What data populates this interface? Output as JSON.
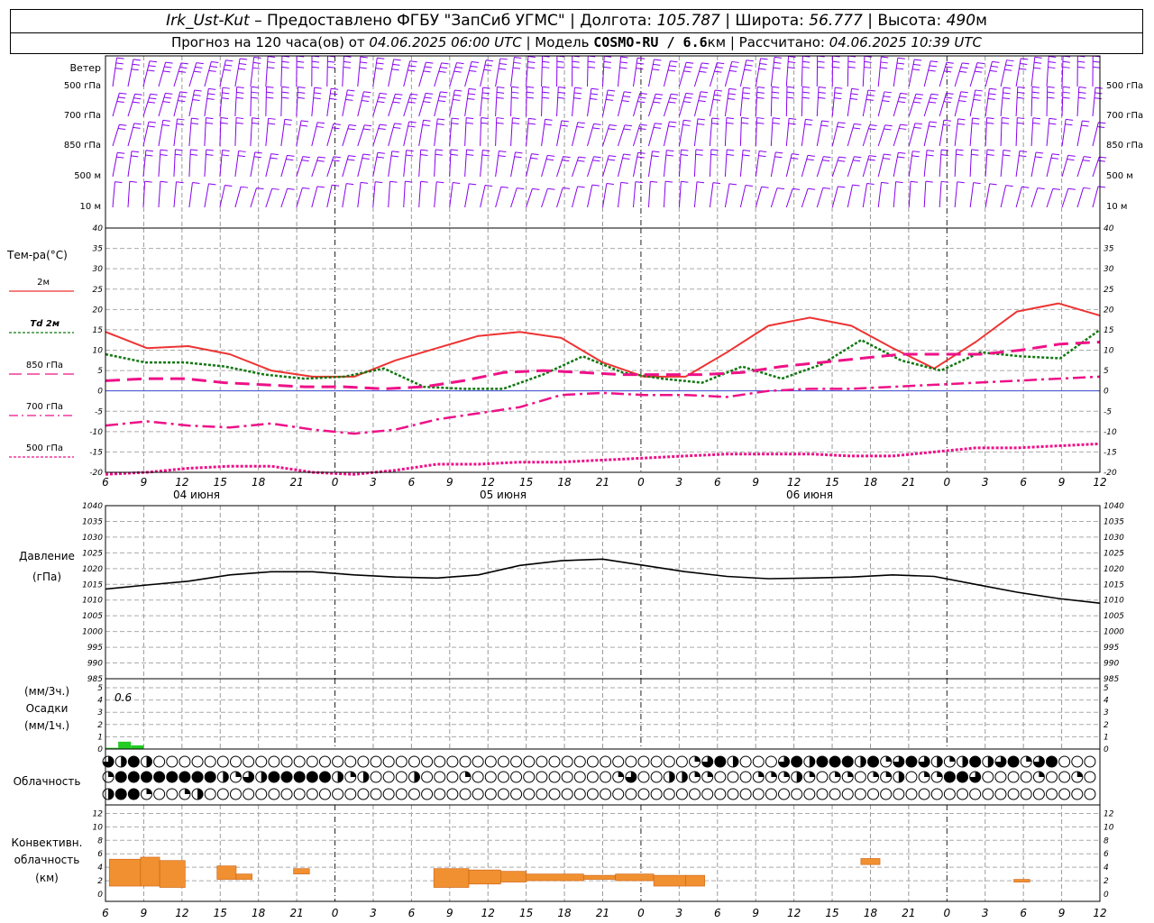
{
  "header": {
    "station": "Irk_Ust-Kut",
    "provider": "– Предоставлено ФГБУ \"ЗапСиб УГМС\" | Долгота:",
    "longitude": "105.787",
    "lat_label": "| Широта:",
    "latitude": "56.777",
    "alt_label": "| Высота:",
    "altitude": "490",
    "alt_unit": "м",
    "forecast_label": "Прогноз на 120 часа(ов) от",
    "forecast_start": "04.06.2025 06:00 UTC",
    "model_label": "| Модель",
    "model": "COSMO-RU / 6.6",
    "model_unit": "км",
    "calc_label": "| Рассчитано:",
    "calc_time": "04.06.2025 10:39 UTC"
  },
  "wind_panel": {
    "title": "Ветер",
    "levels": [
      "500 гПа",
      "700 гПа",
      "850 гПа",
      "500 м",
      "10 м"
    ],
    "color": "#8800ee"
  },
  "temp_panel": {
    "title": "Тем-ра(°C)",
    "legend": [
      {
        "label": "2м",
        "color": "#ee3333"
      },
      {
        "label": "Td 2м",
        "color": "#117711"
      },
      {
        "label": "850 гПа",
        "color": "#ee1188"
      },
      {
        "label": "700 гПа",
        "color": "#ee1188"
      },
      {
        "label": "500 гПа",
        "color": "#ee1188"
      }
    ],
    "ticks": [
      "40",
      "35",
      "30",
      "25",
      "20",
      "15",
      "10",
      "5",
      "0",
      "-5",
      "-10",
      "-15",
      "-20"
    ]
  },
  "pressure_panel": {
    "title": "Давление",
    "unit": "(гПа)",
    "ticks": [
      "1040",
      "1035",
      "1030",
      "1025",
      "1020",
      "1015",
      "1010",
      "1005",
      "1000",
      "995",
      "990",
      "985"
    ]
  },
  "precip_panel": {
    "unit3": "(мм/3ч.)",
    "title": "Осадки",
    "unit1": "(мм/1ч.)",
    "ticks": [
      "5",
      "4",
      "3",
      "2",
      "1",
      "0"
    ],
    "max_label": "0.6"
  },
  "cloud_panel": {
    "title": "Облачность"
  },
  "conv_panel": {
    "title1": "Конвективн.",
    "title2": "облачность",
    "unit": "(км)",
    "ticks": [
      "12",
      "10",
      "8",
      "6",
      "4",
      "2",
      "0"
    ]
  },
  "time_axis": {
    "hours": [
      "6",
      "9",
      "12",
      "15",
      "18",
      "21",
      "0",
      "3",
      "6",
      "9",
      "12",
      "15",
      "18",
      "21",
      "0",
      "3",
      "6",
      "9",
      "12",
      "15",
      "18",
      "21",
      "0",
      "3",
      "6",
      "9",
      "12"
    ],
    "dates": [
      "04 июня",
      "05 июня",
      "06 июня"
    ]
  },
  "chart_data": {
    "type": "line",
    "x_hours": [
      0,
      3,
      6,
      9,
      12,
      15,
      18,
      21,
      24,
      27,
      30,
      33,
      36,
      39,
      42,
      45,
      48,
      51,
      54,
      57,
      60,
      63,
      66,
      69,
      72,
      75,
      78
    ],
    "series": [
      {
        "name": "2м",
        "color": "#ee3333",
        "values": [
          14.5,
          10.5,
          11,
          9,
          5,
          3.5,
          3.5,
          7.5,
          10.5,
          13.5,
          14.5,
          13,
          7,
          3.5,
          3.5,
          9.5,
          16,
          18,
          16,
          10.5,
          5.5,
          12,
          19.5,
          21.5,
          18.5
        ]
      },
      {
        "name": "Td 2м",
        "color": "#117711",
        "values": [
          9,
          7,
          7,
          6,
          4,
          3,
          3.5,
          5.5,
          1,
          0.5,
          0.5,
          4,
          8.5,
          4.5,
          3,
          2,
          6,
          3,
          6.5,
          12.5,
          7.5,
          5,
          9.5,
          8.5,
          8,
          15
        ]
      },
      {
        "name": "850 гПа",
        "color": "#ee1188",
        "values": [
          2.5,
          3,
          3,
          2,
          1.5,
          1,
          1,
          0.5,
          1,
          2.5,
          4.5,
          5,
          4.5,
          4,
          4,
          4,
          4.5,
          6,
          7,
          8,
          9,
          9,
          9,
          10,
          11.5,
          12
        ]
      },
      {
        "name": "700 гПа",
        "color": "#ee1188",
        "values": [
          -8.5,
          -7.5,
          -8.5,
          -9,
          -8,
          -9.5,
          -10.5,
          -9.5,
          -7,
          -5.5,
          -4,
          -1,
          -0.5,
          -1,
          -1,
          -1.5,
          0,
          0.5,
          0.5,
          1,
          1.5,
          2,
          2.5,
          3,
          3.5
        ]
      },
      {
        "name": "500 гПа",
        "color": "#ee1188",
        "values": [
          -21,
          -20,
          -19,
          -18.5,
          -18.5,
          -20,
          -20.5,
          -19.5,
          -18,
          -18,
          -17.5,
          -17.5,
          -17,
          -16.5,
          -16,
          -15.5,
          -15.5,
          -15.5,
          -16,
          -16,
          -15,
          -14,
          -14,
          -13.5,
          -13
        ]
      },
      {
        "name": "Давление",
        "color": "#000000",
        "values": [
          1013.5,
          1014.8,
          1016,
          1018,
          1019,
          1019,
          1018,
          1017.3,
          1017,
          1018,
          1021,
          1022.5,
          1023,
          1021,
          1019,
          1017.5,
          1016.8,
          1017,
          1017.3,
          1018,
          1017.5,
          1015,
          1012.5,
          1010.5,
          1009
        ]
      },
      {
        "name": "Осадки",
        "color": "#22cc22",
        "values": [
          0.1,
          0.6,
          0.3,
          0
        ]
      },
      {
        "name": "Конвективн. облачность",
        "color": "#ee8833",
        "values": []
      }
    ],
    "axes": {
      "temp_ylim": [
        -20,
        40
      ],
      "pressure_ylim": [
        985,
        1040
      ],
      "precip_ylim": [
        0,
        5
      ],
      "conv_ylim": [
        0,
        13
      ]
    },
    "convective": [
      {
        "x0": 0.6,
        "x1": 5.5,
        "bottom": 1.2,
        "top": 5.2
      },
      {
        "x0": 5.5,
        "x1": 8.5,
        "bottom": 1.2,
        "top": 5.5
      },
      {
        "x0": 8.5,
        "x1": 12.5,
        "bottom": 1.0,
        "top": 5.0
      },
      {
        "x0": 17.5,
        "x1": 20.5,
        "bottom": 2.2,
        "top": 4.2
      },
      {
        "x0": 20.5,
        "x1": 23,
        "bottom": 2.2,
        "top": 3.0
      },
      {
        "x0": 29.5,
        "x1": 32,
        "bottom": 3.0,
        "top": 3.8
      },
      {
        "x0": 51.5,
        "x1": 57,
        "bottom": 1.0,
        "top": 3.8
      },
      {
        "x0": 57,
        "x1": 62,
        "bottom": 1.5,
        "top": 3.6
      },
      {
        "x0": 62,
        "x1": 66,
        "bottom": 1.8,
        "top": 3.4
      },
      {
        "x0": 66,
        "x1": 75,
        "bottom": 2.0,
        "top": 3.0
      },
      {
        "x0": 75,
        "x1": 80,
        "bottom": 2.2,
        "top": 2.8
      },
      {
        "x0": 80,
        "x1": 86,
        "bottom": 2.0,
        "top": 3.0
      },
      {
        "x0": 86,
        "x1": 91,
        "bottom": 1.2,
        "top": 2.8
      },
      {
        "x0": 91,
        "x1": 94,
        "bottom": 1.2,
        "top": 2.8
      },
      {
        "x0": 118.5,
        "x1": 121.5,
        "bottom": 4.4,
        "top": 5.3
      },
      {
        "x0": 142.5,
        "x1": 145,
        "bottom": 1.8,
        "top": 2.2
      },
      {
        "x0": 171.5,
        "x1": 177,
        "bottom": 1.8,
        "top": 2.2
      }
    ]
  }
}
